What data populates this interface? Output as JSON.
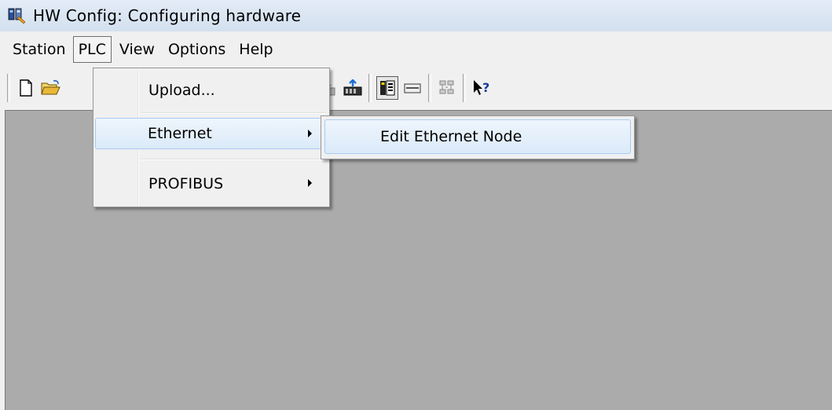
{
  "window": {
    "title": "HW Config: Configuring hardware",
    "icon": "hw-config-app-icon"
  },
  "menubar": {
    "items": [
      {
        "label": "Station",
        "active": false
      },
      {
        "label": "PLC",
        "active": true
      },
      {
        "label": "View",
        "active": false
      },
      {
        "label": "Options",
        "active": false
      },
      {
        "label": "Help",
        "active": false
      }
    ]
  },
  "toolbar": {
    "buttons": [
      "new-document-icon",
      "open-folder-icon",
      "download-icon",
      "upload-icon",
      "hardware-catalog-icon",
      "module-view-icon",
      "network-icon",
      "context-help-icon"
    ]
  },
  "plc_menu": {
    "items": [
      {
        "label": "Upload...",
        "submenu": false,
        "highlighted": false
      },
      {
        "label": "Ethernet",
        "submenu": true,
        "highlighted": true
      },
      {
        "label": "PROFIBUS",
        "submenu": true,
        "highlighted": false
      }
    ]
  },
  "ethernet_submenu": {
    "items": [
      {
        "label": "Edit Ethernet Node",
        "highlighted": true
      }
    ]
  },
  "colors": {
    "workarea": "#ababab",
    "menu_highlight": "#dbeaf9",
    "menu_highlight_border": "#a8cbef"
  }
}
